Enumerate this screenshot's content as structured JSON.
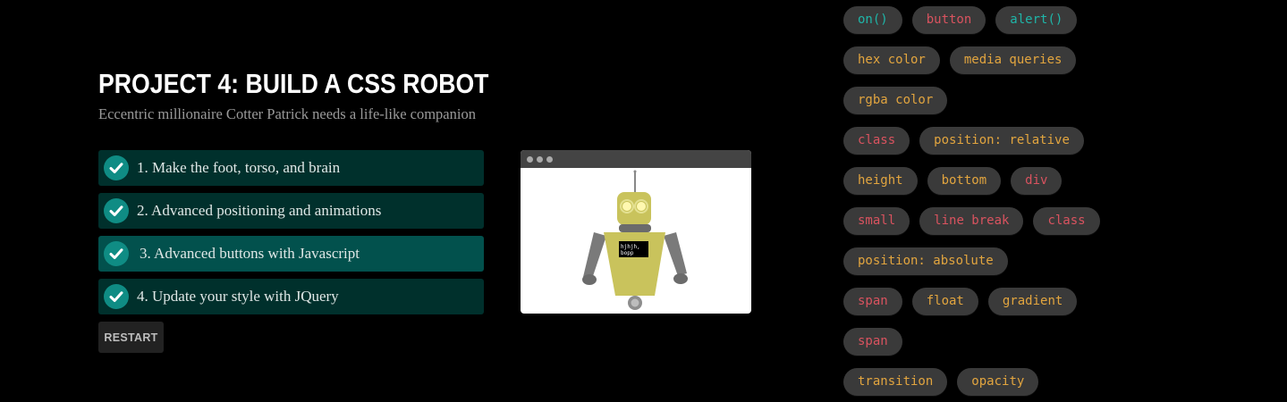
{
  "project": {
    "title": "PROJECT 4: BUILD A CSS ROBOT",
    "subtitle": "Eccentric millionaire Cotter Patrick needs a life-like companion"
  },
  "steps": [
    {
      "label": "1. Make the foot, torso, and brain",
      "active": false
    },
    {
      "label": "2. Advanced positioning and animations",
      "active": false
    },
    {
      "label": "3. Advanced buttons with Javascript",
      "active": true
    },
    {
      "label": "4. Update your style with JQuery",
      "active": false
    }
  ],
  "restart_label": "RESTART",
  "robot": {
    "speech_line1": "hjhjh,",
    "speech_line2": "bopp"
  },
  "tag_colors": {
    "teal": "#1fb5a8",
    "red": "#d9535f",
    "orange": "#e2a53f"
  },
  "tag_rows": [
    [
      {
        "text": "on()",
        "color": "teal"
      },
      {
        "text": "button",
        "color": "red"
      },
      {
        "text": "alert()",
        "color": "teal"
      }
    ],
    [
      {
        "text": "hex color",
        "color": "orange"
      },
      {
        "text": "media queries",
        "color": "orange"
      }
    ],
    [
      {
        "text": "rgba color",
        "color": "orange"
      }
    ],
    [
      {
        "text": "class",
        "color": "red"
      },
      {
        "text": "position: relative",
        "color": "orange"
      }
    ],
    [
      {
        "text": "height",
        "color": "orange"
      },
      {
        "text": "bottom",
        "color": "orange"
      },
      {
        "text": "div",
        "color": "red"
      }
    ],
    [
      {
        "text": "small",
        "color": "red"
      },
      {
        "text": "line break",
        "color": "red"
      },
      {
        "text": "class",
        "color": "red"
      }
    ],
    [
      {
        "text": "position: absolute",
        "color": "orange"
      }
    ],
    [
      {
        "text": "span",
        "color": "red"
      },
      {
        "text": "float",
        "color": "orange"
      },
      {
        "text": "gradient",
        "color": "orange"
      }
    ],
    [
      {
        "text": "span",
        "color": "red"
      }
    ],
    [
      {
        "text": "transition",
        "color": "orange"
      },
      {
        "text": "opacity",
        "color": "orange"
      }
    ]
  ]
}
